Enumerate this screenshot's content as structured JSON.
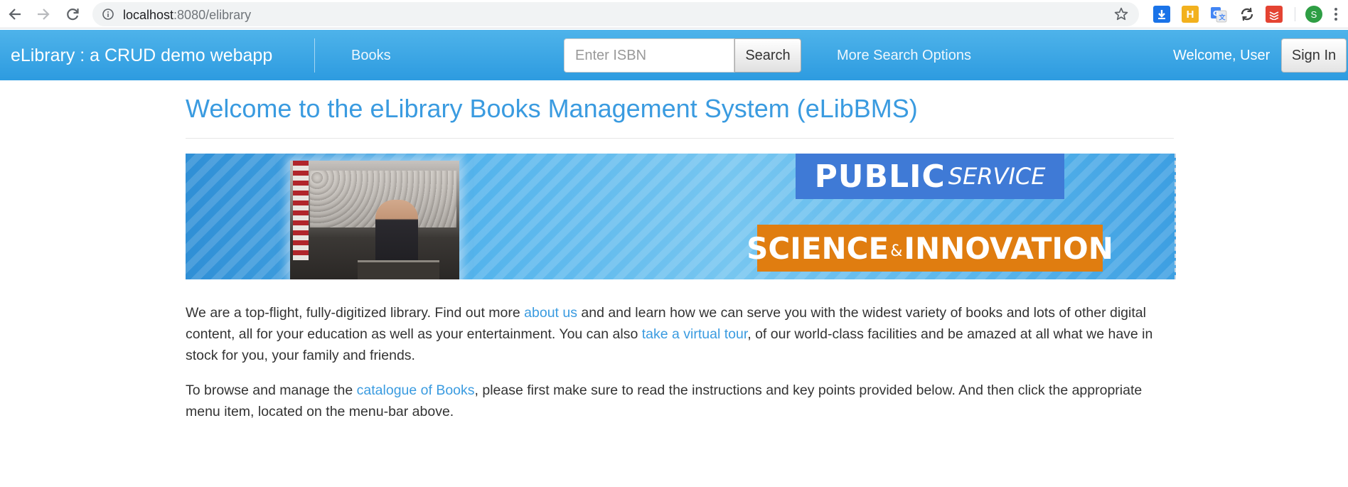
{
  "browser": {
    "url_host": "localhost",
    "url_rest": ":8080/elibrary",
    "profile_initial": "S",
    "extensions": [
      {
        "name": "download-icon",
        "color": "#1a73e8",
        "label": ""
      },
      {
        "name": "h-extension-icon",
        "color": "#f2b11e",
        "label": "H"
      },
      {
        "name": "translate-icon",
        "color": "#4285f4",
        "label": ""
      },
      {
        "name": "sync-icon",
        "color": "#444444",
        "label": ""
      },
      {
        "name": "todoist-icon",
        "color": "#e44332",
        "label": ""
      }
    ]
  },
  "navbar": {
    "brand": "eLibrary : a CRUD demo webapp",
    "books_link": "Books",
    "isbn_placeholder": "Enter ISBN",
    "search_label": "Search",
    "more_options_link": "More Search Options",
    "welcome_text": "Welcome, User",
    "signin_label": "Sign In",
    "accent": "#2d9be0"
  },
  "main": {
    "title": "Welcome to the eLibrary Books Management System (eLibBMS)",
    "banner": {
      "public_word": "PUBLIC",
      "service_word": "SERVICE",
      "science_word": "SCIENCE",
      "amp": "&",
      "innovation_word": "INNOVATION"
    },
    "paragraph1": {
      "text_a": "We are a top-flight, fully-digitized library. Find out more ",
      "link_about": "about us",
      "text_b": " and and learn how we can serve you with the widest variety of books and lots of other digital content, all for your education as well as your entertainment. You can also ",
      "link_tour": "take a virtual tour",
      "text_c": ", of our world-class facilities and be amazed at all what we have in stock for you, your family and friends."
    },
    "paragraph2": {
      "text_a": "To browse and manage the ",
      "link_catalogue": "catalogue of Books",
      "text_b": ", please first make sure to read the instructions and key points provided below. And then click the appropriate menu item, located on the menu-bar above."
    },
    "link_color": "#3a9be0"
  }
}
